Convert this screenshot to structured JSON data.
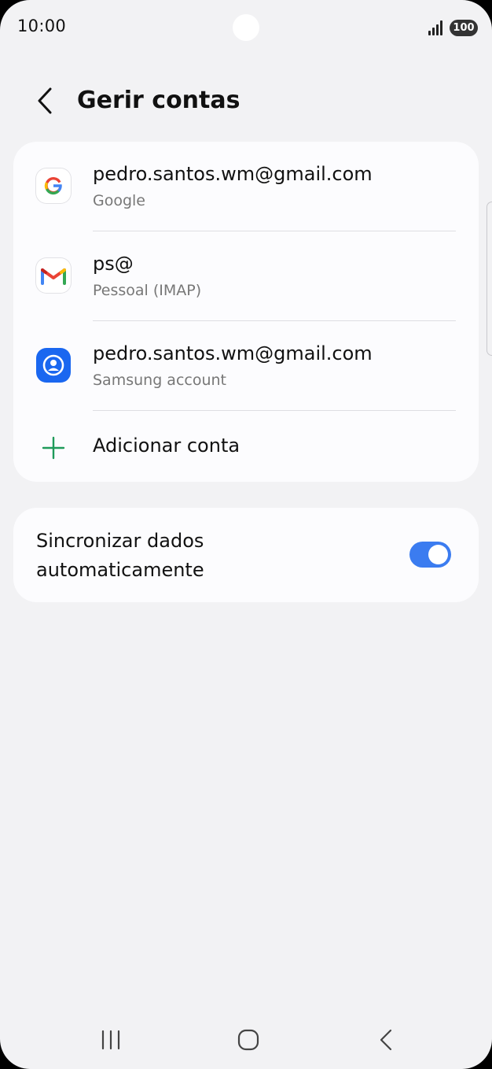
{
  "status_bar": {
    "time": "10:00",
    "battery": "100",
    "icons": [
      "signal-icon",
      "battery-icon"
    ]
  },
  "header": {
    "title": "Gerir contas",
    "back_icon": "chevron-left-icon"
  },
  "accounts": [
    {
      "email": "pedro.santos.wm@gmail.com",
      "type": "Google",
      "icon": "google-icon"
    },
    {
      "email": "ps@",
      "type": "Pessoal (IMAP)",
      "icon": "gmail-icon"
    },
    {
      "email": "pedro.santos.wm@gmail.com",
      "type": "Samsung account",
      "icon": "samsung-account-icon"
    }
  ],
  "add_account": {
    "label": "Adicionar conta",
    "icon": "plus-icon"
  },
  "sync": {
    "label": "Sincronizar dados automaticamente",
    "enabled": true
  },
  "colors": {
    "background": "#f2f2f4",
    "card": "#fcfcfe",
    "accent": "#3b7cf0",
    "plus_green": "#1f9a5a",
    "samsung_blue": "#1a67f0"
  },
  "nav_bar": {
    "icons": [
      "recent-apps-icon",
      "home-icon",
      "back-icon"
    ]
  }
}
